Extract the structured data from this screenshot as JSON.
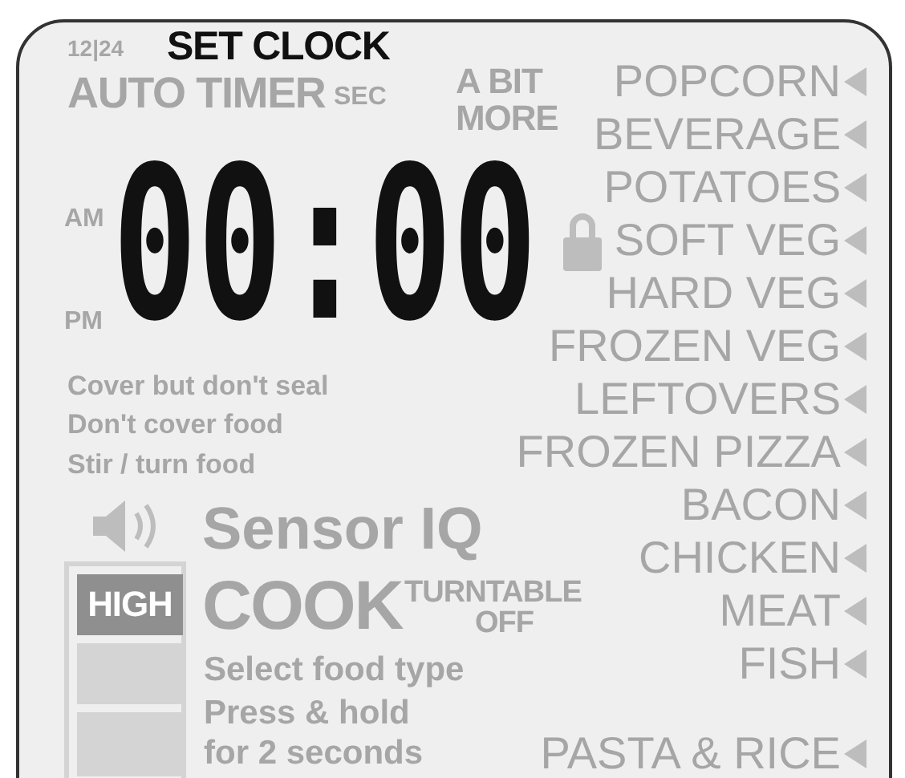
{
  "clock_format": {
    "text": "12|24",
    "on": false
  },
  "set_clock": {
    "text": "SET CLOCK",
    "on": true
  },
  "auto_timer": {
    "text": "AUTO TIMER",
    "on": false
  },
  "sec": {
    "text": "SEC",
    "on": false
  },
  "a_bit_more": {
    "lines": [
      "A BIT",
      "MORE"
    ],
    "on": false
  },
  "time": {
    "text": "00:00",
    "on": true
  },
  "am": {
    "text": "AM",
    "on": false
  },
  "pm": {
    "text": "PM",
    "on": false
  },
  "lock": {
    "on": false
  },
  "instructions": [
    {
      "text": "Cover but don't seal",
      "on": false
    },
    {
      "text": "Don't cover food",
      "on": false
    },
    {
      "text": "Stir / turn food",
      "on": false
    }
  ],
  "sound": {
    "on": false
  },
  "sensor": {
    "text": "Sensor IQ",
    "on": false
  },
  "cook": {
    "text": "COOK",
    "on": false
  },
  "turntable": {
    "lines": [
      "TURNTABLE",
      "OFF"
    ],
    "on": false
  },
  "prompts": [
    {
      "text": "Select food type",
      "on": false
    },
    {
      "text": "Press & hold",
      "on": false
    },
    {
      "text": "for 2 seconds",
      "on": false
    }
  ],
  "power": {
    "text": "HIGH",
    "on": false
  },
  "foods": [
    {
      "text": "POPCORN",
      "on": false
    },
    {
      "text": "BEVERAGE",
      "on": false
    },
    {
      "text": "POTATOES",
      "on": false
    },
    {
      "text": "SOFT VEG",
      "on": false
    },
    {
      "text": "HARD VEG",
      "on": false
    },
    {
      "text": "FROZEN VEG",
      "on": false
    },
    {
      "text": "LEFTOVERS",
      "on": false
    },
    {
      "text": "FROZEN PIZZA",
      "on": false
    },
    {
      "text": "BACON",
      "on": false
    },
    {
      "text": "CHICKEN",
      "on": false
    },
    {
      "text": "MEAT",
      "on": false
    },
    {
      "text": "FISH",
      "on": false
    },
    {
      "text": "PASTA & RICE",
      "on": false
    }
  ]
}
